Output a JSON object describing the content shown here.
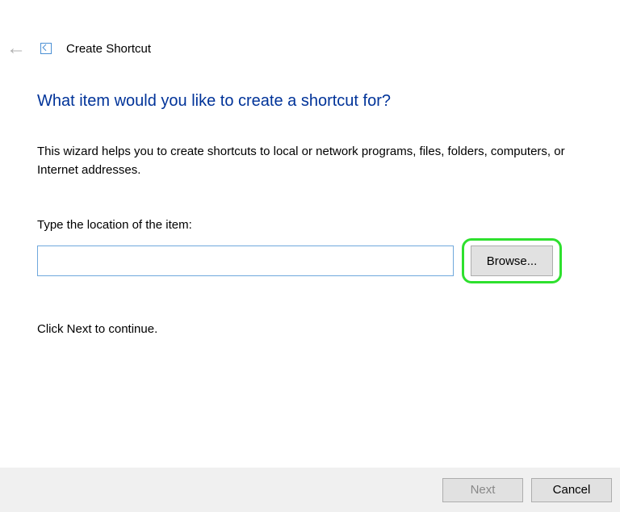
{
  "header": {
    "window_title": "Create Shortcut"
  },
  "main": {
    "heading": "What item would you like to create a shortcut for?",
    "description": "This wizard helps you to create shortcuts to local or network programs, files, folders, computers, or Internet addresses.",
    "location_label": "Type the location of the item:",
    "location_value": "",
    "browse_label": "Browse...",
    "instruction": "Click Next to continue."
  },
  "footer": {
    "next_label": "Next",
    "cancel_label": "Cancel"
  }
}
